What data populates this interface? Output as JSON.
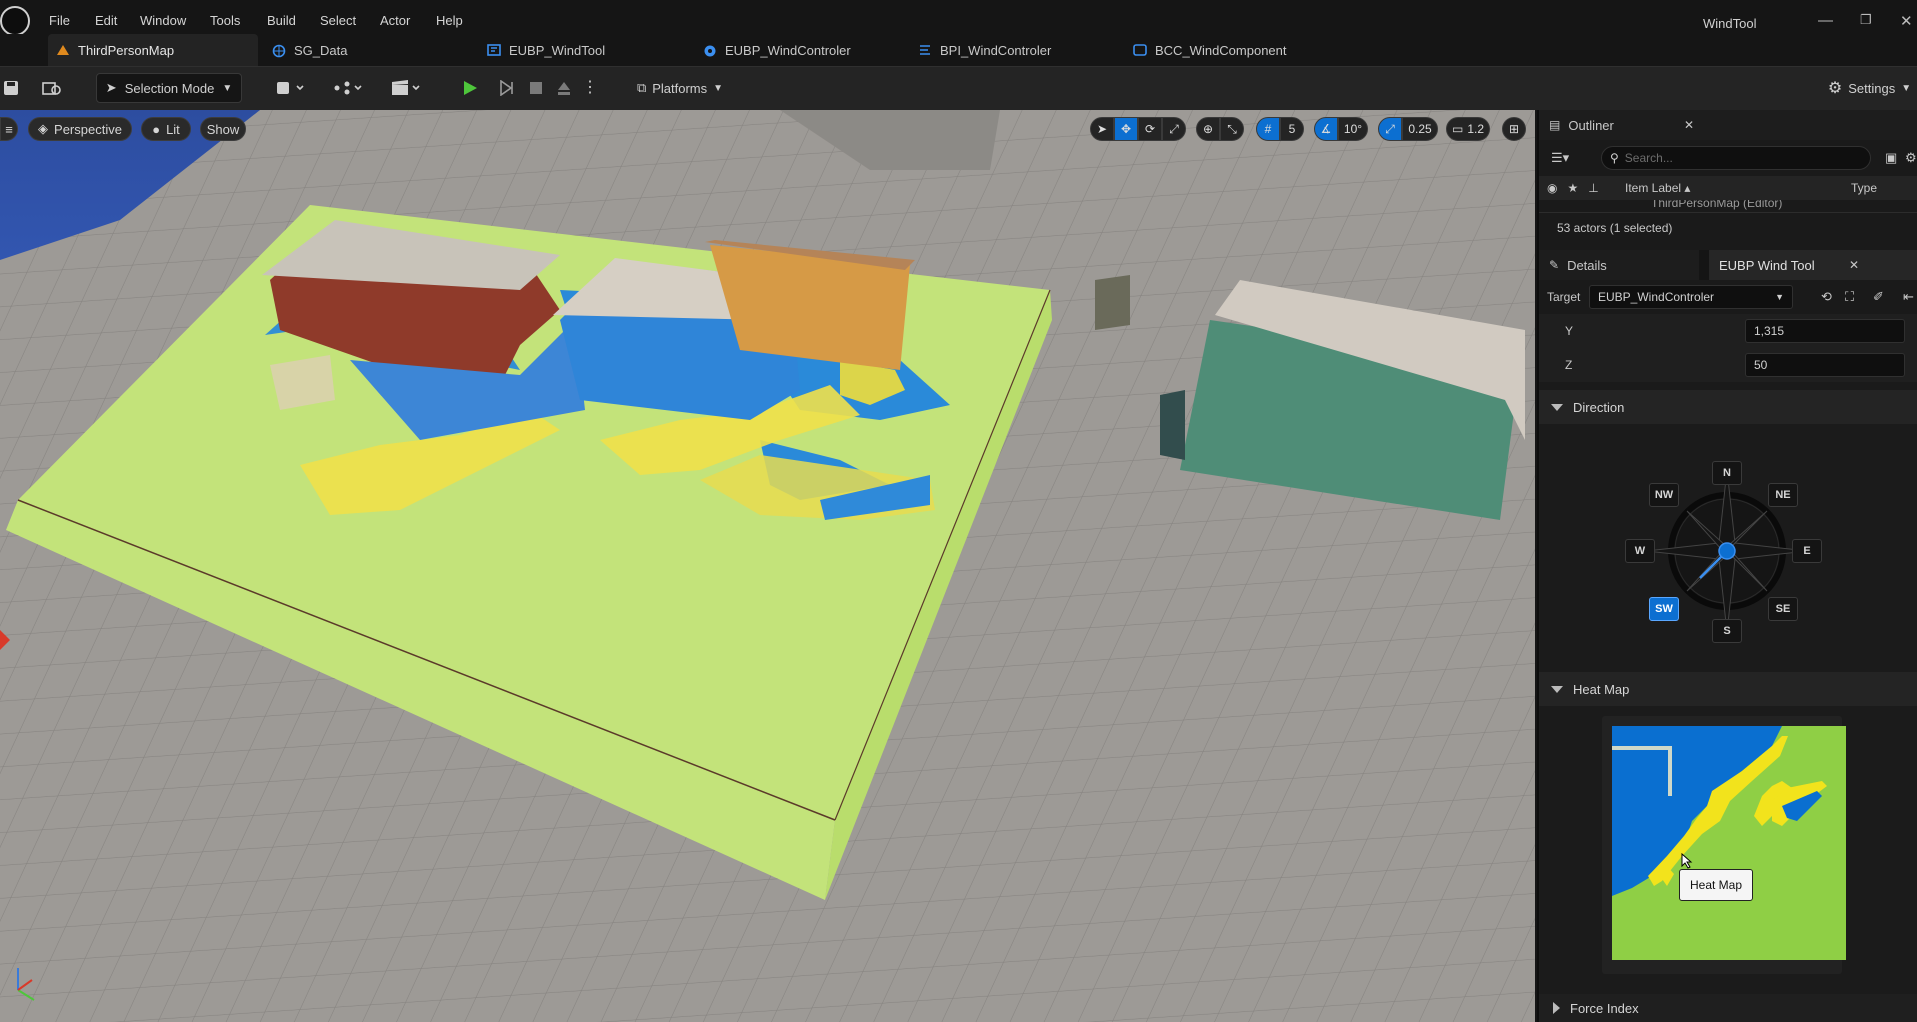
{
  "app": {
    "title": "WindTool",
    "menu": [
      "File",
      "Edit",
      "Window",
      "Tools",
      "Build",
      "Select",
      "Actor",
      "Help"
    ]
  },
  "tabs": [
    {
      "label": "ThirdPersonMap",
      "icon": "level-icon",
      "color": "#e08a1e"
    },
    {
      "label": "SG_Data",
      "icon": "globe-icon",
      "color": "#3b8ff0"
    },
    {
      "label": "EUBP_WindTool",
      "icon": "widget-blueprint-icon",
      "color": "#3b8ff0"
    },
    {
      "label": "EUBP_WindControler",
      "icon": "utility-actor-icon",
      "color": "#3b8ff0"
    },
    {
      "label": "BPI_WindControler",
      "icon": "interface-icon",
      "color": "#3b8ff0"
    },
    {
      "label": "BCC_WindComponent",
      "icon": "component-icon",
      "color": "#3b8ff0"
    }
  ],
  "toolbar": {
    "selection_mode": "Selection Mode",
    "platforms": "Platforms",
    "settings": "Settings"
  },
  "viewport": {
    "perspective": "Perspective",
    "lit": "Lit",
    "show": "Show",
    "grid_value": "5",
    "angle_value": "10°",
    "scale_value": "0.25",
    "camera_speed": "1.2"
  },
  "outliner": {
    "title": "Outliner",
    "search_placeholder": "Search...",
    "col_item_label": "Item Label ▴",
    "col_type": "Type",
    "first_item": "ThirdPersonMap (Editor)",
    "summary": "53 actors (1 selected)"
  },
  "details": {
    "details_tab": "Details",
    "wind_tool_tab": "EUBP Wind Tool",
    "target_label": "Target",
    "target_value": "EUBP_WindControler",
    "y_label": "Y",
    "y_value": "1,315",
    "z_label": "Z",
    "z_value": "50"
  },
  "direction": {
    "section": "Direction",
    "labels": {
      "n": "N",
      "ne": "NE",
      "e": "E",
      "se": "SE",
      "s": "S",
      "sw": "SW",
      "w": "W",
      "nw": "NW"
    },
    "selected": "SW"
  },
  "heatmap": {
    "section": "Heat Map",
    "tooltip": "Heat Map"
  },
  "force_index": {
    "section": "Force Index"
  },
  "colors": {
    "accent": "#0c6fd1",
    "heat_low": "#8fcf45",
    "heat_mid": "#f2e31c",
    "heat_high": "#0a6fd0",
    "play_green": "#4ec63b"
  }
}
